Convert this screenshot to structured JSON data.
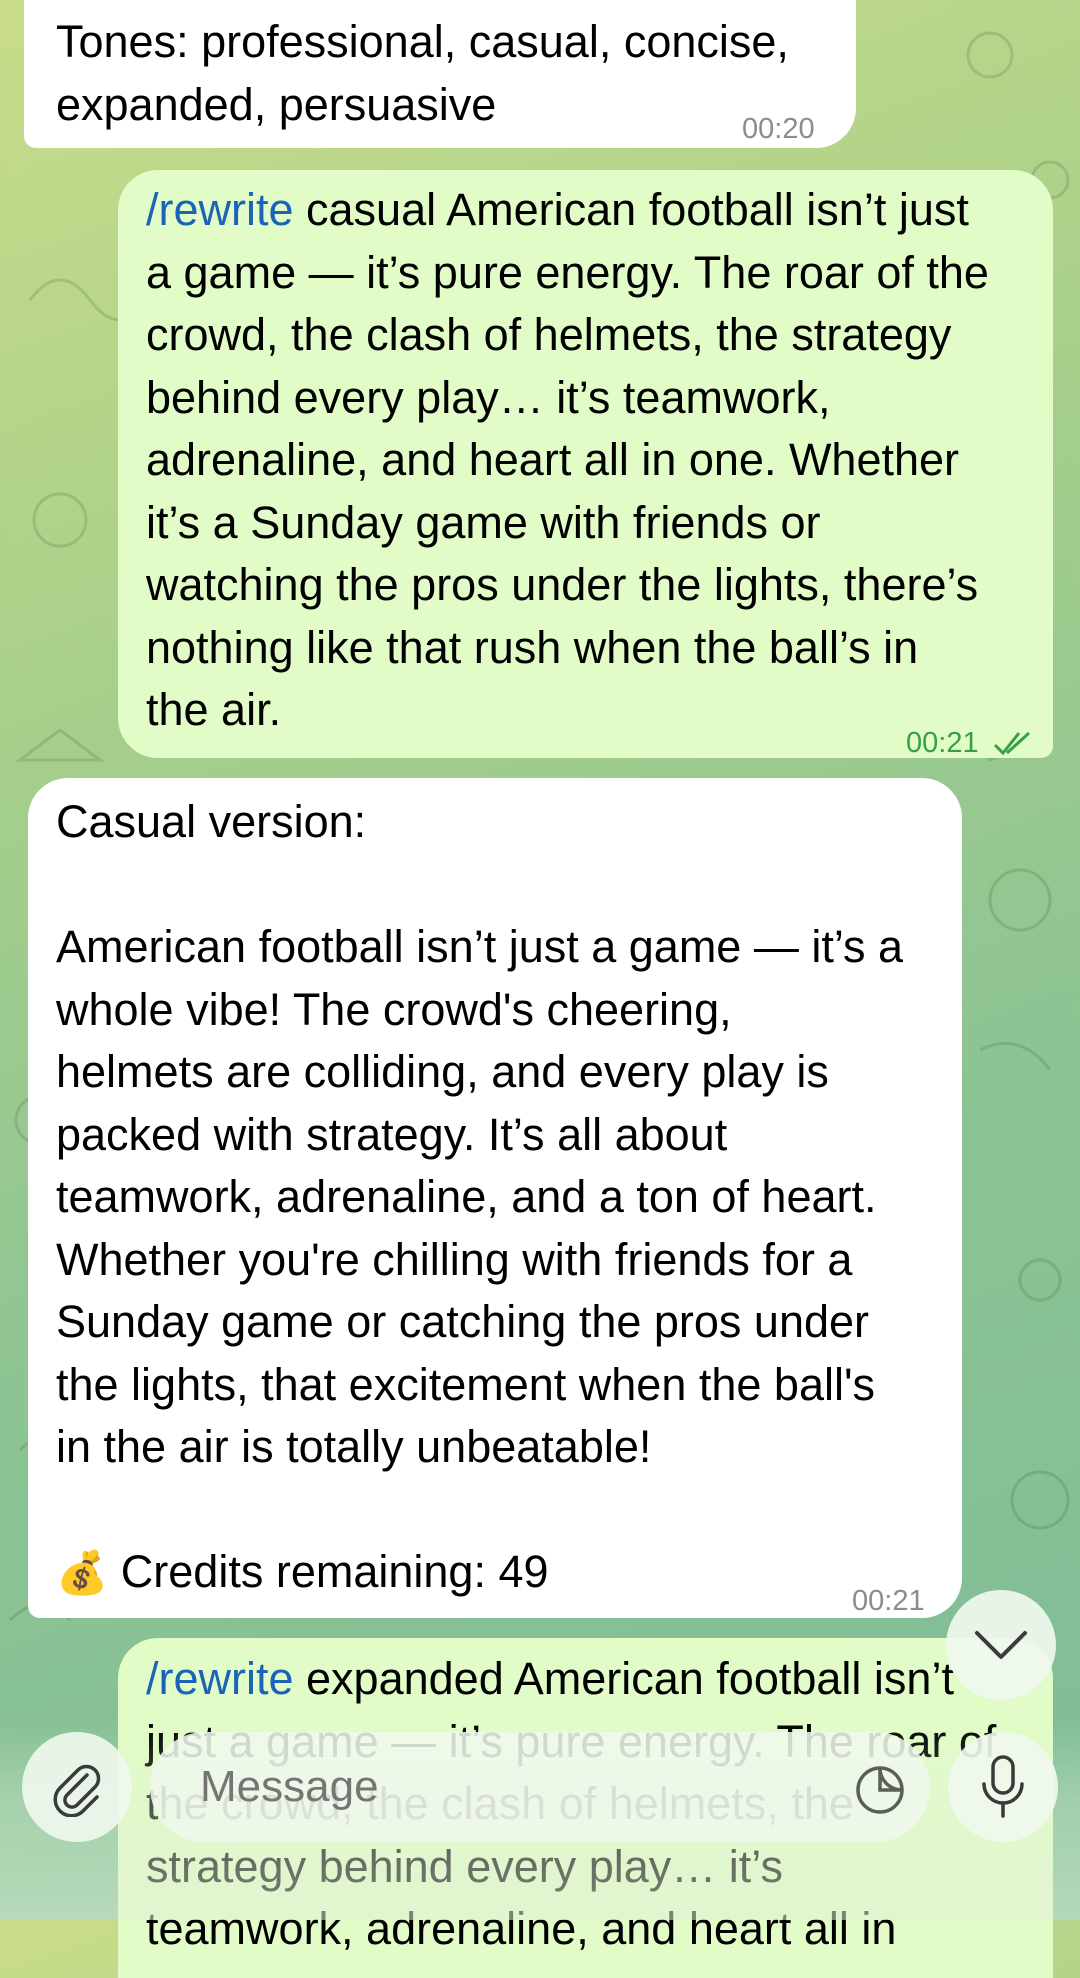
{
  "messages": [
    {
      "direction": "incoming",
      "text": "Tones: professional, casual, concise,\nexpanded, persuasive",
      "time": "00:20"
    },
    {
      "direction": "outgoing",
      "command": "/rewrite",
      "text": " casual American football isn’t just\na game — it’s pure energy. The roar of the\ncrowd, the clash of helmets, the strategy\nbehind every play… it’s teamwork,\nadrenaline, and heart all in one. Whether\nit’s a Sunday game with friends or\nwatching the pros under the lights, there’s\nnothing like that rush when the ball’s in\nthe air.",
      "time": "00:21",
      "status": "read"
    },
    {
      "direction": "incoming",
      "text": "Casual version:\n\nAmerican football isn’t just a game — it’s a\nwhole vibe! The crowd's cheering,\nhelmets are colliding, and every play is\npacked with strategy. It’s all about\nteamwork, adrenaline, and a ton of heart.\nWhether you're chilling with friends for a\nSunday game or catching the pros under\nthe lights, that excitement when the ball's\nin the air is totally unbeatable!",
      "credits_icon": "money-bag-icon",
      "credits_emoji": "💰",
      "credits_text": " Credits remaining: 49",
      "time": "00:21"
    },
    {
      "direction": "outgoing",
      "command": "/rewrite",
      "text": " expanded American football isn’t\njust a game — it’s pure energy. The roar of\nthe crowd, the clash of helmets, the\nstrategy behind every play… it’s\nteamwork, adrenaline, and heart all in"
    }
  ],
  "composer": {
    "placeholder": "Message",
    "attach_icon": "paperclip-icon",
    "sticker_icon": "sticker-icon",
    "mic_icon": "microphone-icon",
    "scroll_icon": "chevron-down-icon"
  },
  "colors": {
    "incoming_bubble": "#ffffff",
    "outgoing_bubble": "#e1fcc6",
    "command_link": "#1a63b8",
    "outgoing_time": "#35a047"
  }
}
